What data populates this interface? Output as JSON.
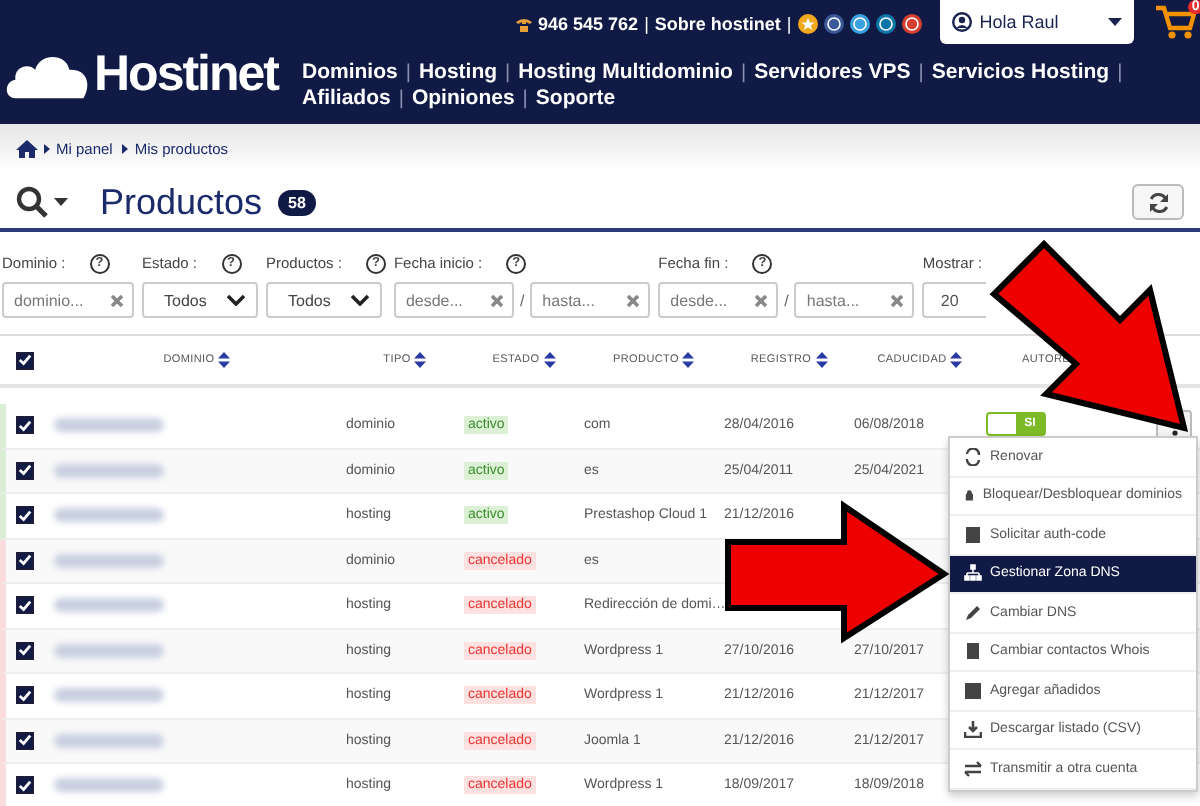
{
  "header": {
    "logo": "Hostinet",
    "phone": "946 545 762",
    "top_separators": [
      "|",
      "|"
    ],
    "about": "Sobre hostinet",
    "user": "Hola Raul",
    "cart_count": "0",
    "nav_separator": "|",
    "nav": [
      "Dominios",
      "Hosting",
      "Hosting Multidominio",
      "Servidores VPS",
      "Servicios Hosting",
      "Afiliados",
      "Opiniones",
      "Soporte"
    ]
  },
  "breadcrumb": [
    "Mi panel",
    "Mis productos"
  ],
  "title": "Productos",
  "count": "58",
  "filters": [
    {
      "kind": "text",
      "label": "Dominio :",
      "help": "?",
      "fields": [
        {
          "placeholder": "dominio..."
        }
      ]
    },
    {
      "kind": "select",
      "label": "Estado :",
      "help": "?",
      "value": "Todos"
    },
    {
      "kind": "select",
      "label": "Productos :",
      "help": "?",
      "value": "Todos"
    },
    {
      "kind": "range",
      "label": "Fecha inicio :",
      "help": "?",
      "separator": "/",
      "fields": [
        {
          "placeholder": "desde..."
        },
        {
          "placeholder": "hasta..."
        }
      ]
    },
    {
      "kind": "range",
      "label": "Fecha fin :",
      "help": "?",
      "separator": "/",
      "fields": [
        {
          "placeholder": "desde..."
        },
        {
          "placeholder": "hasta..."
        }
      ]
    },
    {
      "kind": "plain",
      "label": "Mostrar :",
      "value": "20"
    }
  ],
  "table": {
    "all_checked": true,
    "columns": [
      {
        "label": "DOMINIO",
        "sortable": true
      },
      {
        "label": "TIPO",
        "sortable": true
      },
      {
        "label": "ESTADO",
        "sortable": true
      },
      {
        "label": "PRODUCTO",
        "sortable": true
      },
      {
        "label": "REGISTRO",
        "sortable": true
      },
      {
        "label": "CADUCIDAD",
        "sortable": true
      },
      {
        "label": "AUTORE",
        "sortable": false
      }
    ],
    "rows": [
      {
        "checked": true,
        "tipo": "dominio",
        "estado": "activo",
        "active": true,
        "producto": "com",
        "registro": "28/04/2016",
        "caducidad": "06/08/2018",
        "autorenew": {
          "on": true,
          "label": "SI"
        },
        "menu_button": true
      },
      {
        "checked": true,
        "tipo": "dominio",
        "estado": "activo",
        "active": true,
        "producto": "es",
        "registro": "25/04/2011",
        "caducidad": "25/04/2021"
      },
      {
        "checked": true,
        "tipo": "hosting",
        "estado": "activo",
        "active": true,
        "producto": "Prestashop Cloud 1",
        "registro": "21/12/2016"
      },
      {
        "checked": true,
        "tipo": "dominio",
        "estado": "cancelado",
        "active": false,
        "producto": "es"
      },
      {
        "checked": true,
        "tipo": "hosting",
        "estado": "cancelado",
        "active": false,
        "producto": "Redirección de domi…"
      },
      {
        "checked": true,
        "tipo": "hosting",
        "estado": "cancelado",
        "active": false,
        "producto": "Wordpress 1",
        "registro": "27/10/2016",
        "caducidad": "27/10/2017"
      },
      {
        "checked": true,
        "tipo": "hosting",
        "estado": "cancelado",
        "active": false,
        "producto": "Wordpress 1",
        "registro": "21/12/2016",
        "caducidad": "21/12/2017"
      },
      {
        "checked": true,
        "tipo": "hosting",
        "estado": "cancelado",
        "active": false,
        "producto": "Joomla 1",
        "registro": "21/12/2016",
        "caducidad": "21/12/2017"
      },
      {
        "checked": true,
        "tipo": "hosting",
        "estado": "cancelado",
        "active": false,
        "producto": "Wordpress 1",
        "registro": "18/09/2017",
        "caducidad": "18/09/2018"
      }
    ]
  },
  "menu": [
    {
      "label": "Renovar",
      "selected": false
    },
    {
      "label": "Bloquear/Desbloquear dominios",
      "selected": false
    },
    {
      "label": "Solicitar auth-code",
      "selected": false
    },
    {
      "label": "Gestionar Zona DNS",
      "selected": true
    },
    {
      "label": "Cambiar DNS",
      "selected": false
    },
    {
      "label": "Cambiar contactos Whois",
      "selected": false
    },
    {
      "label": "Agregar añadidos",
      "selected": false
    },
    {
      "label": "Descargar listado (CSV)",
      "selected": false
    },
    {
      "label": "Transmitir a otra cuenta",
      "selected": false
    }
  ]
}
